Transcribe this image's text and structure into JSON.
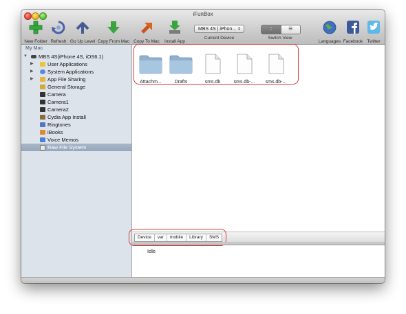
{
  "window": {
    "title": "iFunBox"
  },
  "toolbar": {
    "new_folder": "New Folder",
    "refresh": "Refresh",
    "go_up": "Go Up Level",
    "copy_from_mac": "Copy From Mac",
    "copy_to_mac": "Copy To Mac",
    "install_app": "Install App",
    "device_select": "MBS 4S | iPhon...",
    "current_device": "Current Device",
    "switch_view": "Switch View",
    "languages": "Languages",
    "facebook": "Facebook",
    "twitter": "Twitter"
  },
  "sidebar": {
    "header": "My Mac",
    "device": "MBS 4S(iPhone 4S, iOS6.1)",
    "items": [
      {
        "label": "User Applications"
      },
      {
        "label": "System Applications"
      },
      {
        "label": "App File Sharing"
      },
      {
        "label": "General Storage"
      },
      {
        "label": "Camera"
      },
      {
        "label": "Camera1"
      },
      {
        "label": "Camera2"
      },
      {
        "label": "Cydia App Install"
      },
      {
        "label": "Ringtones"
      },
      {
        "label": "iBooks"
      },
      {
        "label": "Voice Memos"
      },
      {
        "label": "Raw File System"
      }
    ]
  },
  "files": [
    {
      "name": "Attachm...",
      "icon": "folder-icon"
    },
    {
      "name": "Drafts",
      "icon": "folder-icon"
    },
    {
      "name": "sms.db",
      "icon": "file-icon"
    },
    {
      "name": "sms.db-...",
      "icon": "file-icon"
    },
    {
      "name": "sms.db-...",
      "icon": "file-icon"
    }
  ],
  "path": [
    "Device",
    "var",
    "mobile",
    "Library",
    "SMS"
  ],
  "status": "Idle",
  "colors": {
    "highlight": "#d63a3a",
    "selection": "#97a6ba"
  }
}
